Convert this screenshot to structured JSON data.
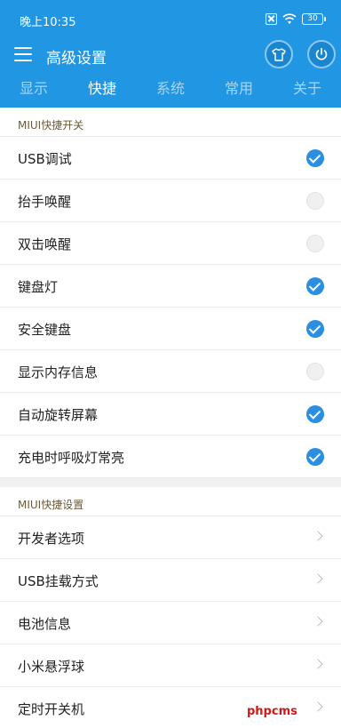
{
  "status_bar": {
    "time": "晚上10:35",
    "battery": "30"
  },
  "toolbar": {
    "title": "高级设置"
  },
  "tabs": [
    "显示",
    "快捷",
    "系统",
    "常用",
    "关于"
  ],
  "active_tab": "快捷",
  "sections": {
    "quick_switches": {
      "header": "MIUI快捷开关",
      "items": [
        {
          "label": "USB调试",
          "checked": true
        },
        {
          "label": "抬手唤醒",
          "checked": false
        },
        {
          "label": "双击唤醒",
          "checked": false
        },
        {
          "label": "键盘灯",
          "checked": true
        },
        {
          "label": "安全键盘",
          "checked": true
        },
        {
          "label": "显示内存信息",
          "checked": false
        },
        {
          "label": "自动旋转屏幕",
          "checked": true
        },
        {
          "label": "充电时呼吸灯常亮",
          "checked": true
        }
      ]
    },
    "quick_settings": {
      "header": "MIUI快捷设置",
      "items": [
        {
          "label": "开发者选项"
        },
        {
          "label": "USB挂载方式"
        },
        {
          "label": "电池信息"
        },
        {
          "label": "小米悬浮球"
        },
        {
          "label": "定时开关机"
        }
      ]
    }
  },
  "watermark": "phpcms",
  "colors": {
    "header": "#2196e3",
    "check_on": "#2a8fe0",
    "section_header_text": "#6b5a3a",
    "watermark": "#d01818"
  },
  "icons": [
    "menu-icon",
    "t-shirt-icon",
    "power-icon",
    "sim-icon",
    "wifi-icon",
    "battery-icon",
    "check-icon",
    "chevron-right-icon"
  ]
}
